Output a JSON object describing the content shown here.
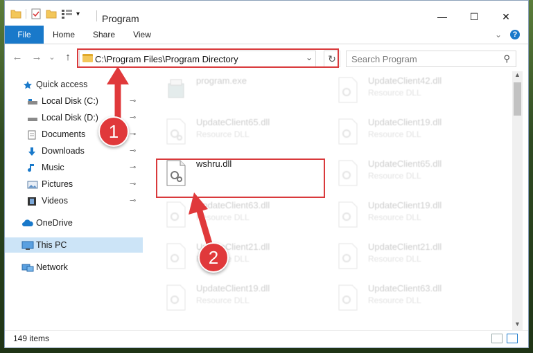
{
  "window": {
    "title": "Program",
    "minimize": "—",
    "maximize": "☐",
    "close": "✕"
  },
  "ribbon": {
    "tabs": [
      "File",
      "Home",
      "Share",
      "View"
    ],
    "collapse": "⌄",
    "help": "?"
  },
  "navigation": {
    "back": "←",
    "forward": "→",
    "recent": "⌄",
    "up": "↑",
    "address": "C:\\Program Files\\Program Directory",
    "address_dropdown": "⌄",
    "refresh": "↻",
    "search_placeholder": "Search Program",
    "search_icon": "⚲"
  },
  "sidebar": {
    "items": [
      {
        "label": "Quick access",
        "icon": "star-icon",
        "color": "#1979ca"
      },
      {
        "label": "Local Disk (C:)",
        "icon": "drive-icon",
        "pinned": true
      },
      {
        "label": "Local Disk (D:)",
        "icon": "drive-icon",
        "pinned": true
      },
      {
        "label": "Documents",
        "icon": "documents-icon",
        "pinned": true
      },
      {
        "label": "Downloads",
        "icon": "download-icon",
        "pinned": true
      },
      {
        "label": "Music",
        "icon": "music-icon",
        "pinned": true
      },
      {
        "label": "Pictures",
        "icon": "pictures-icon",
        "pinned": true
      },
      {
        "label": "Videos",
        "icon": "videos-icon",
        "pinned": true
      },
      {
        "label": "OneDrive",
        "icon": "onedrive-icon"
      },
      {
        "label": "This PC",
        "icon": "computer-icon",
        "selected": true
      },
      {
        "label": "Network",
        "icon": "network-icon"
      }
    ],
    "pin_glyph": "📌"
  },
  "files": [
    {
      "name": "program.exe",
      "type": "",
      "faded": true
    },
    {
      "name": "UpdateClient42.dll",
      "type": "Resource DLL",
      "faded": true
    },
    {
      "name": "UpdateClient65.dll",
      "type": "Resource DLL",
      "faded": true
    },
    {
      "name": "UpdateClient19.dll",
      "type": "Resource DLL",
      "faded": true
    },
    {
      "name": "wshru.dll",
      "type": "",
      "faded": false
    },
    {
      "name": "UpdateClient65.dll",
      "type": "Resource DLL",
      "faded": true
    },
    {
      "name": "UpdateClient63.dll",
      "type": "Resource DLL",
      "faded": true
    },
    {
      "name": "UpdateClient19.dll",
      "type": "Resource DLL",
      "faded": true
    },
    {
      "name": "UpdateClient21.dll",
      "type": "Resource DLL",
      "faded": true
    },
    {
      "name": "UpdateClient21.dll",
      "type": "Resource DLL",
      "faded": true
    },
    {
      "name": "UpdateClient19.dll",
      "type": "Resource DLL",
      "faded": true
    },
    {
      "name": "UpdateClient63.dll",
      "type": "Resource DLL",
      "faded": true
    }
  ],
  "status": {
    "item_count": "149 items"
  },
  "callouts": [
    {
      "number": "1"
    },
    {
      "number": "2"
    }
  ],
  "colors": {
    "accent": "#1979ca",
    "highlight_red": "#d9393b",
    "selected_bg": "#cce4f7"
  }
}
